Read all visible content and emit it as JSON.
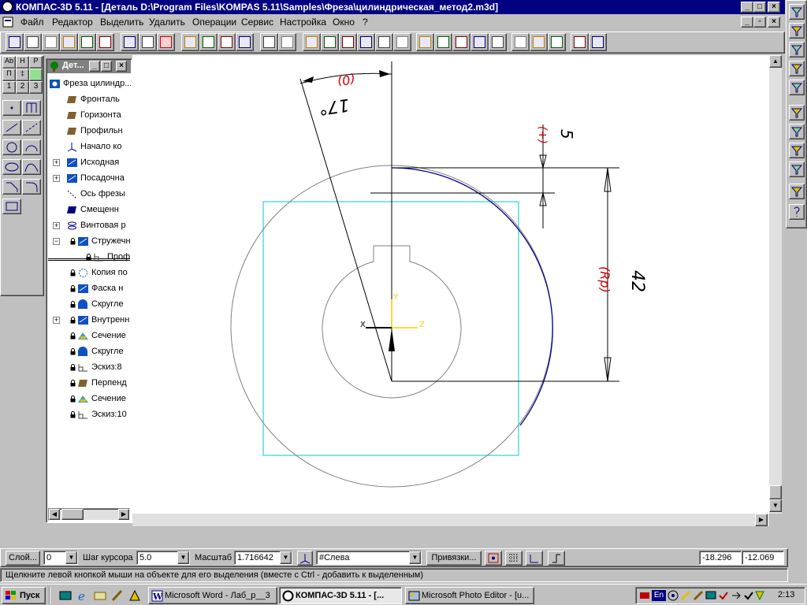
{
  "window": {
    "title": "КОМПАС-3D 5.11 - [Деталь D:\\Program Files\\KOMPAS 5.11\\Samples\\Фреза\\цилиндрическая_метод2.m3d]"
  },
  "menu": [
    {
      "label": "Файл"
    },
    {
      "label": "Редактор"
    },
    {
      "label": "Выделить"
    },
    {
      "label": "Удалить"
    },
    {
      "label": "Операции"
    },
    {
      "label": "Сервис"
    },
    {
      "label": "Настройка"
    },
    {
      "label": "Окно"
    },
    {
      "label": "?"
    }
  ],
  "toolbar_icons": [
    "open-model-icon",
    "save-model-icon",
    "new-sheet-icon",
    "new-fragment-icon",
    "new-spec-icon",
    "new-part-icon",
    "open-icon",
    "save-icon",
    "cancel-red-icon",
    "cut-icon",
    "copy-icon",
    "paste-icon",
    "copy-props-icon",
    "undo-icon",
    "redo-icon",
    "zoom-window-icon",
    "zoom-in-icon",
    "zoom-out-icon",
    "pan-icon",
    "zoom-fit-icon",
    "rotate-icon",
    "wireframe-icon",
    "hidden-lines-icon",
    "no-hidden-icon",
    "shaded-icon",
    "orient-icon",
    "measure-icon",
    "properties-icon",
    "library-icon",
    "help-icon",
    "exit-icon"
  ],
  "left_palette": {
    "top_labels": [
      "Аb",
      "Н",
      "Р",
      "П",
      "‡",
      "1",
      "2",
      "3"
    ]
  },
  "tree": {
    "title": "Дет...",
    "root": "Фреза цилиндр...",
    "items": [
      {
        "label": "Фронталь"
      },
      {
        "label": "Горизонта"
      },
      {
        "label": "Профильн"
      },
      {
        "label": "Начало ко"
      },
      {
        "label": "Исходная"
      },
      {
        "label": "Посадочна"
      },
      {
        "label": "Ось фрезы"
      },
      {
        "label": "Смещенн"
      },
      {
        "label": "Винтовая р"
      },
      {
        "label": "Стружечн"
      },
      {
        "label": "Проф"
      },
      {
        "label": "Копия по"
      },
      {
        "label": "Фаска н"
      },
      {
        "label": "Скругле"
      },
      {
        "label": "Внутренн"
      },
      {
        "label": "Сечение"
      },
      {
        "label": "Скругле"
      },
      {
        "label": "Эскиз:8"
      },
      {
        "label": "Перпенд"
      },
      {
        "label": "Сечение"
      },
      {
        "label": "Эскиз:10"
      }
    ]
  },
  "drawing": {
    "dim_angle": "17°",
    "dim_angle_tol": "(0)",
    "dim_small": "5",
    "dim_small_tol": "(+)",
    "dim_radius": "42",
    "dim_radius_tol": "(Rp)",
    "axis_y": "Y",
    "axis_z": "Z",
    "axis_x": "X"
  },
  "propbar": {
    "layer_button": "Слой...",
    "layer_value": "0",
    "step_label": "Шаг курсора",
    "step_value": "5.0",
    "scale_label": "Масштаб",
    "scale_value": "1.716642",
    "view_value": "#Слева",
    "snap_button": "Привязки...",
    "coord_x": "-18.296",
    "coord_y": "-12.069"
  },
  "status": {
    "message": "Щелкните левой кнопкой мыши на объекте для его выделения (вместе с Ctrl - добавить к выделенным)"
  },
  "taskbar": {
    "start": "Пуск",
    "tasks": [
      {
        "label": "Microsoft Word - Лаб_р__3"
      },
      {
        "label": "КОМПАС-3D 5.11 - [..."
      },
      {
        "label": "Microsoft Photo Editor - [u..."
      }
    ],
    "lang": "En",
    "clock": "2:13"
  },
  "colors": {
    "titlebar": "#000080",
    "arc_blue": "#00008b",
    "cyan_frame": "#00c8d8",
    "dim_red": "#d00000",
    "axis_yellow": "#f0d000"
  }
}
